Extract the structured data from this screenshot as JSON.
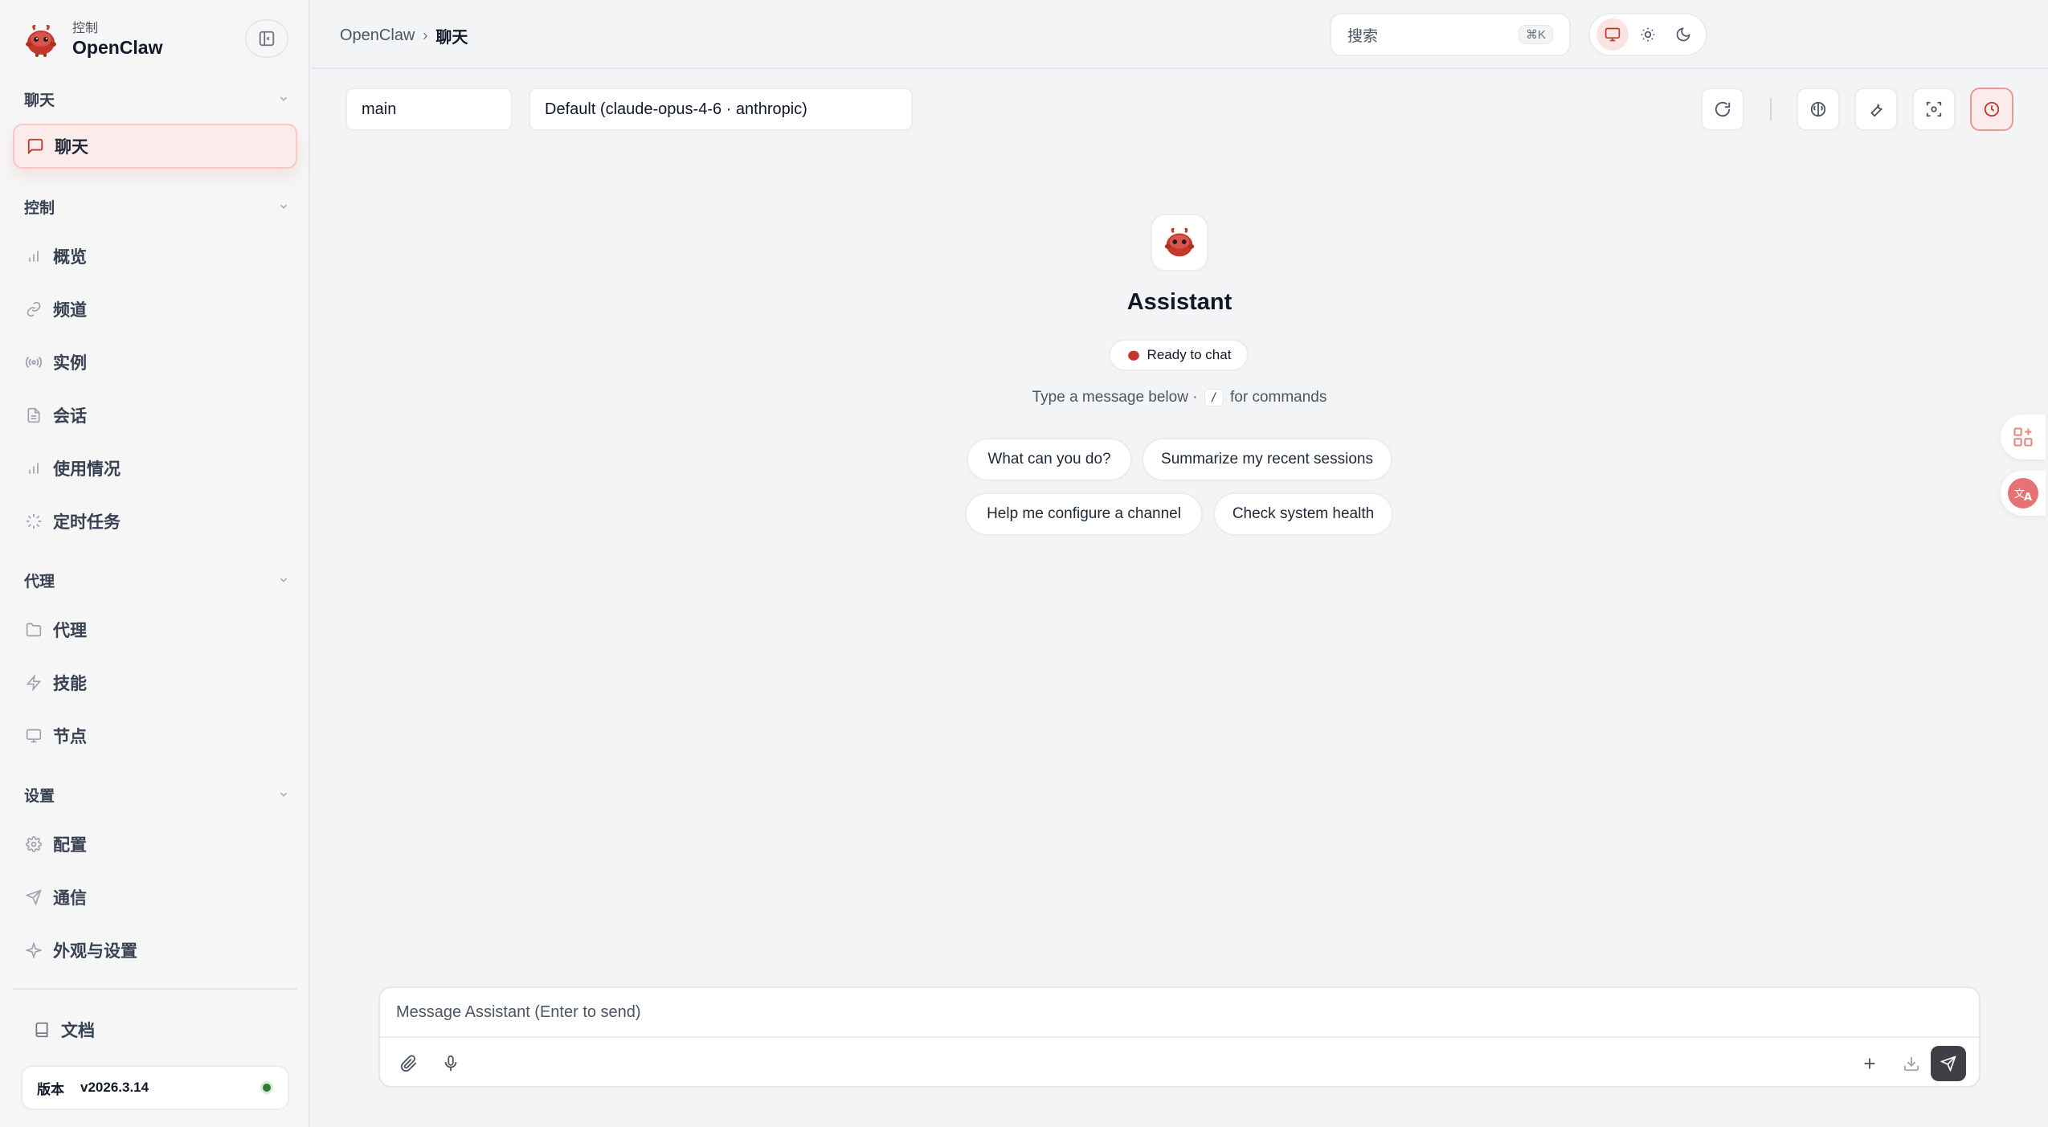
{
  "colors": {
    "accent": "#c0392b",
    "accent_soft": "#fbeceb",
    "status_online": "#2e7d32"
  },
  "brand": {
    "subtitle": "控制",
    "name": "OpenClaw"
  },
  "sidebar": {
    "sections": [
      {
        "title": "聊天",
        "items": [
          {
            "label": "聊天",
            "icon": "message-square-icon",
            "active": true
          }
        ]
      },
      {
        "title": "控制",
        "items": [
          {
            "label": "概览",
            "icon": "bar-chart-icon"
          },
          {
            "label": "频道",
            "icon": "link-icon"
          },
          {
            "label": "实例",
            "icon": "radio-icon"
          },
          {
            "label": "会话",
            "icon": "file-text-icon"
          },
          {
            "label": "使用情况",
            "icon": "bar-chart-icon"
          },
          {
            "label": "定时任务",
            "icon": "loader-icon"
          }
        ]
      },
      {
        "title": "代理",
        "items": [
          {
            "label": "代理",
            "icon": "folder-icon"
          },
          {
            "label": "技能",
            "icon": "zap-icon"
          },
          {
            "label": "节点",
            "icon": "monitor-icon"
          }
        ]
      },
      {
        "title": "设置",
        "items": [
          {
            "label": "配置",
            "icon": "gear-icon"
          },
          {
            "label": "通信",
            "icon": "send-icon"
          },
          {
            "label": "外观与设置",
            "icon": "sparkle-icon"
          }
        ]
      }
    ],
    "docs_label": "文档",
    "version_label": "版本",
    "version_value": "v2026.3.14"
  },
  "header": {
    "breadcrumb_root": "OpenClaw",
    "breadcrumb_separator": "›",
    "breadcrumb_current": "聊天",
    "search_placeholder": "搜索",
    "search_shortcut": "⌘K"
  },
  "toolbar": {
    "session_value": "main",
    "model_value": "Default (claude-opus-4-6 · anthropic)"
  },
  "welcome": {
    "title": "Assistant",
    "status": "Ready to chat",
    "hint_before": "Type a message below ·",
    "hint_key": "/",
    "hint_after": "for commands",
    "suggestions": [
      "What can you do?",
      "Summarize my recent sessions",
      "Help me configure a channel",
      "Check system health"
    ]
  },
  "composer": {
    "placeholder": "Message Assistant (Enter to send)"
  }
}
